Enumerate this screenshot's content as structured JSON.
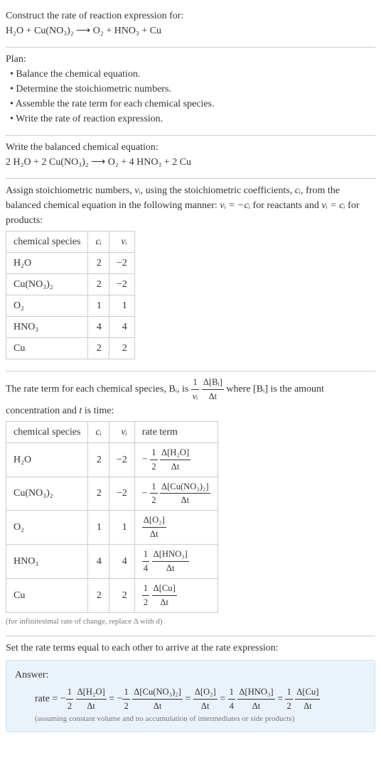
{
  "intro": {
    "prompt": "Construct the rate of reaction expression for:",
    "equation": "H₂O + Cu(NO₃)₂ ⟶ O₂ + HNO₃ + Cu"
  },
  "plan": {
    "heading": "Plan:",
    "items": [
      "• Balance the chemical equation.",
      "• Determine the stoichiometric numbers.",
      "• Assemble the rate term for each chemical species.",
      "• Write the rate of reaction expression."
    ]
  },
  "balanced": {
    "heading": "Write the balanced chemical equation:",
    "equation": "2 H₂O + 2 Cu(NO₃)₂ ⟶ O₂ + 4 HNO₃ + 2 Cu"
  },
  "stoich": {
    "heading_part1": "Assign stoichiometric numbers, ",
    "nu_i": "νᵢ",
    "heading_part2": ", using the stoichiometric coefficients, ",
    "c_i": "cᵢ",
    "heading_part3": ", from the balanced chemical equation in the following manner: ",
    "rel_reactants": "νᵢ = −cᵢ",
    "for_reactants": " for reactants and ",
    "rel_products": "νᵢ = cᵢ",
    "for_products": " for products:",
    "table": {
      "headers": [
        "chemical species",
        "cᵢ",
        "νᵢ"
      ],
      "rows": [
        {
          "species": "H₂O",
          "c": "2",
          "nu": "−2"
        },
        {
          "species": "Cu(NO₃)₂",
          "c": "2",
          "nu": "−2"
        },
        {
          "species": "O₂",
          "c": "1",
          "nu": "1"
        },
        {
          "species": "HNO₃",
          "c": "4",
          "nu": "4"
        },
        {
          "species": "Cu",
          "c": "2",
          "nu": "2"
        }
      ]
    }
  },
  "rateterm": {
    "heading_a": "The rate term for each chemical species, Bᵢ, is ",
    "frac1_top": "1",
    "frac1_bot": "νᵢ",
    "frac2_top": "Δ[Bᵢ]",
    "frac2_bot": "Δt",
    "heading_b": " where [Bᵢ] is the amount concentration and ",
    "t": "t",
    "heading_c": " is time:",
    "table": {
      "headers": [
        "chemical species",
        "cᵢ",
        "νᵢ",
        "rate term"
      ],
      "rows": [
        {
          "species": "H₂O",
          "c": "2",
          "nu": "−2",
          "pre": "−",
          "f1t": "1",
          "f1b": "2",
          "f2t": "Δ[H₂O]",
          "f2b": "Δt"
        },
        {
          "species": "Cu(NO₃)₂",
          "c": "2",
          "nu": "−2",
          "pre": "−",
          "f1t": "1",
          "f1b": "2",
          "f2t": "Δ[Cu(NO₃)₂]",
          "f2b": "Δt"
        },
        {
          "species": "O₂",
          "c": "1",
          "nu": "1",
          "pre": "",
          "f1t": "",
          "f1b": "",
          "f2t": "Δ[O₂]",
          "f2b": "Δt"
        },
        {
          "species": "HNO₃",
          "c": "4",
          "nu": "4",
          "pre": "",
          "f1t": "1",
          "f1b": "4",
          "f2t": "Δ[HNO₃]",
          "f2b": "Δt"
        },
        {
          "species": "Cu",
          "c": "2",
          "nu": "2",
          "pre": "",
          "f1t": "1",
          "f1b": "2",
          "f2t": "Δ[Cu]",
          "f2b": "Δt"
        }
      ]
    },
    "note": "(for infinitesimal rate of change, replace Δ with d)"
  },
  "final": {
    "heading": "Set the rate terms equal to each other to arrive at the rate expression:",
    "answer_label": "Answer:",
    "rate_prefix": "rate = ",
    "terms": [
      {
        "pre": "−",
        "f1t": "1",
        "f1b": "2",
        "f2t": "Δ[H₂O]",
        "f2b": "Δt"
      },
      {
        "pre": "−",
        "f1t": "1",
        "f1b": "2",
        "f2t": "Δ[Cu(NO₃)₂]",
        "f2b": "Δt"
      },
      {
        "pre": "",
        "f1t": "",
        "f1b": "",
        "f2t": "Δ[O₂]",
        "f2b": "Δt"
      },
      {
        "pre": "",
        "f1t": "1",
        "f1b": "4",
        "f2t": "Δ[HNO₃]",
        "f2b": "Δt"
      },
      {
        "pre": "",
        "f1t": "1",
        "f1b": "2",
        "f2t": "Δ[Cu]",
        "f2b": "Δt"
      }
    ],
    "eq": " = ",
    "note": "(assuming constant volume and no accumulation of intermediates or side products)"
  }
}
